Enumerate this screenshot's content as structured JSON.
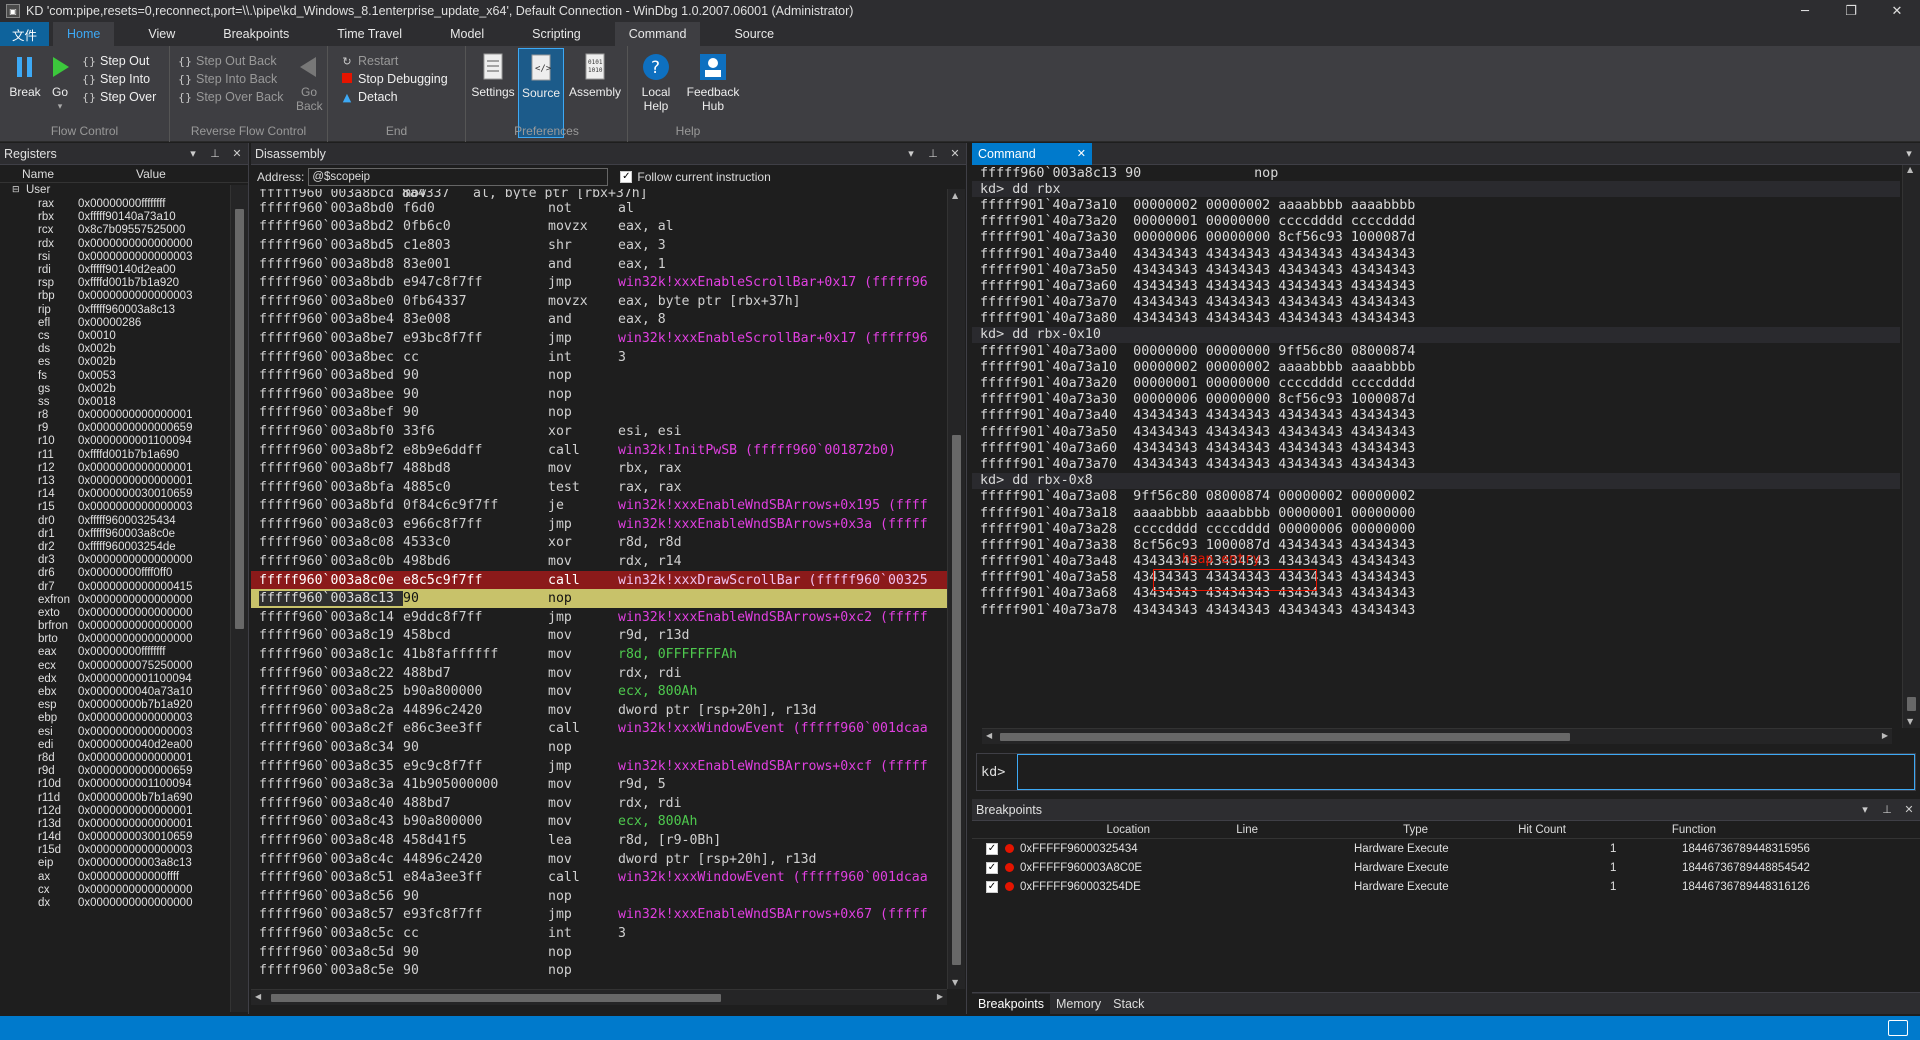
{
  "title": "KD 'com:pipe,resets=0,reconnect,port=\\\\.\\pipe\\kd_Windows_8.1enterprise_update_x64', Default Connection - WinDbg 1.0.2007.06001 (Administrator)",
  "ribbon_tabs": [
    "文件",
    "Home",
    "View",
    "Breakpoints",
    "Time Travel",
    "Model",
    "Scripting",
    "Command",
    "Source"
  ],
  "ribbon": {
    "flow": {
      "break": "Break",
      "go": "Go",
      "step_out": "Step Out",
      "step_into": "Step Into",
      "step_over": "Step Over",
      "label": "Flow Control"
    },
    "reverse": {
      "step_out_back": "Step Out Back",
      "step_into_back": "Step Into Back",
      "step_over_back": "Step Over Back",
      "go_back": "Go Back",
      "label": "Reverse Flow Control"
    },
    "end": {
      "restart": "Restart",
      "stop": "Stop Debugging",
      "detach": "Detach",
      "label": "End"
    },
    "prefs": {
      "settings": "Settings",
      "source": "Source",
      "assembly": "Assembly",
      "label": "Preferences"
    },
    "help": {
      "local_help": "Local Help",
      "feedback_hub": "Feedback Hub",
      "label": "Help"
    }
  },
  "registers": {
    "title": "Registers",
    "col_name": "Name",
    "col_value": "Value",
    "group": "User",
    "rows": [
      [
        "rax",
        "0x00000000ffffffff"
      ],
      [
        "rbx",
        "0xfffff90140a73a10"
      ],
      [
        "rcx",
        "0x8c7b09557525000"
      ],
      [
        "rdx",
        "0x0000000000000000"
      ],
      [
        "rsi",
        "0x0000000000000003"
      ],
      [
        "rdi",
        "0xfffff90140d2ea00"
      ],
      [
        "rsp",
        "0xffffd001b7b1a920"
      ],
      [
        "rbp",
        "0x0000000000000003"
      ],
      [
        "rip",
        "0xfffff960003a8c13"
      ],
      [
        "efl",
        "0x00000286"
      ],
      [
        "cs",
        "0x0010"
      ],
      [
        "ds",
        "0x002b"
      ],
      [
        "es",
        "0x002b"
      ],
      [
        "fs",
        "0x0053"
      ],
      [
        "gs",
        "0x002b"
      ],
      [
        "ss",
        "0x0018"
      ],
      [
        "r8",
        "0x0000000000000001"
      ],
      [
        "r9",
        "0x0000000000000659"
      ],
      [
        "r10",
        "0x0000000001100094"
      ],
      [
        "r11",
        "0xffffd001b7b1a690"
      ],
      [
        "r12",
        "0x0000000000000001"
      ],
      [
        "r13",
        "0x0000000000000001"
      ],
      [
        "r14",
        "0x0000000030010659"
      ],
      [
        "r15",
        "0x0000000000000003"
      ],
      [
        "dr0",
        "0xfffff96000325434"
      ],
      [
        "dr1",
        "0xfffff960003a8c0e"
      ],
      [
        "dr2",
        "0xfffff960003254de"
      ],
      [
        "dr3",
        "0x0000000000000000"
      ],
      [
        "dr6",
        "0x00000000ffff0ff0"
      ],
      [
        "dr7",
        "0x0000000000000415"
      ],
      [
        "exfron",
        "0x0000000000000000"
      ],
      [
        "exto",
        "0x0000000000000000"
      ],
      [
        "brfron",
        "0x0000000000000000"
      ],
      [
        "brto",
        "0x0000000000000000"
      ],
      [
        "eax",
        "0x00000000ffffffff"
      ],
      [
        "ecx",
        "0x0000000075250000"
      ],
      [
        "edx",
        "0x0000000001100094"
      ],
      [
        "ebx",
        "0x0000000040a73a10"
      ],
      [
        "esp",
        "0x00000000b7b1a920"
      ],
      [
        "ebp",
        "0x0000000000000003"
      ],
      [
        "esi",
        "0x0000000000000003"
      ],
      [
        "edi",
        "0x0000000040d2ea00"
      ],
      [
        "r8d",
        "0x0000000000000001"
      ],
      [
        "r9d",
        "0x0000000000000659"
      ],
      [
        "r10d",
        "0x0000000001100094"
      ],
      [
        "r11d",
        "0x00000000b7b1a690"
      ],
      [
        "r12d",
        "0x0000000000000001"
      ],
      [
        "r13d",
        "0x0000000000000001"
      ],
      [
        "r14d",
        "0x0000000030010659"
      ],
      [
        "r15d",
        "0x0000000000000003"
      ],
      [
        "eip",
        "0x00000000003a8c13"
      ],
      [
        "ax",
        "0x000000000000ffff"
      ],
      [
        "cx",
        "0x0000000000000000"
      ],
      [
        "dx",
        "0x0000000000000000"
      ]
    ]
  },
  "disassembly": {
    "title": "Disassembly",
    "address_label": "Address:",
    "address_value": "@$scopeip",
    "follow_label": "Follow current instruction",
    "top_partial": [
      "fffff960`003a8bcd 8a4337",
      "mov",
      "al, byte ptr [rbx+37h]"
    ],
    "rows": [
      [
        "fffff960`003a8bd0",
        "f6d0",
        "not",
        "al",
        "n"
      ],
      [
        "fffff960`003a8bd2",
        "0fb6c0",
        "movzx",
        "eax, al",
        "n"
      ],
      [
        "fffff960`003a8bd5",
        "c1e803",
        "shr",
        "eax, 3",
        "n"
      ],
      [
        "fffff960`003a8bd8",
        "83e001",
        "and",
        "eax, 1",
        "n"
      ],
      [
        "fffff960`003a8bdb",
        "e947c8f7ff",
        "jmp",
        "win32k!xxxEnableScrollBar+0x17 (fffff96",
        "s"
      ],
      [
        "fffff960`003a8be0",
        "0fb64337",
        "movzx",
        "eax, byte ptr [rbx+37h]",
        "n"
      ],
      [
        "fffff960`003a8be4",
        "83e008",
        "and",
        "eax, 8",
        "n"
      ],
      [
        "fffff960`003a8be7",
        "e93bc8f7ff",
        "jmp",
        "win32k!xxxEnableScrollBar+0x17 (fffff96",
        "s"
      ],
      [
        "fffff960`003a8bec",
        "cc",
        "int",
        "3",
        "n"
      ],
      [
        "fffff960`003a8bed",
        "90",
        "nop",
        "",
        "n"
      ],
      [
        "fffff960`003a8bee",
        "90",
        "nop",
        "",
        "n"
      ],
      [
        "fffff960`003a8bef",
        "90",
        "nop",
        "",
        "n"
      ],
      [
        "fffff960`003a8bf0",
        "33f6",
        "xor",
        "esi, esi",
        "n"
      ],
      [
        "fffff960`003a8bf2",
        "e8b9e6ddff",
        "call",
        "win32k!InitPwSB (fffff960`001872b0)",
        "s"
      ],
      [
        "fffff960`003a8bf7",
        "488bd8",
        "mov",
        "rbx, rax",
        "n"
      ],
      [
        "fffff960`003a8bfa",
        "4885c0",
        "test",
        "rax, rax",
        "n"
      ],
      [
        "fffff960`003a8bfd",
        "0f84c6c9f7ff",
        "je",
        "win32k!xxxEnableWndSBArrows+0x195 (ffff",
        "s"
      ],
      [
        "fffff960`003a8c03",
        "e966c8f7ff",
        "jmp",
        "win32k!xxxEnableWndSBArrows+0x3a (fffff",
        "s"
      ],
      [
        "fffff960`003a8c08",
        "4533c0",
        "xor",
        "r8d, r8d",
        "n"
      ],
      [
        "fffff960`003a8c0b",
        "498bd6",
        "mov",
        "rdx, r14",
        "n"
      ],
      [
        "fffff960`003a8c0e",
        "e8c5c9f7ff",
        "call",
        "win32k!xxxDrawScrollBar (fffff960`00325",
        "bp"
      ],
      [
        "fffff960`003a8c13",
        "90",
        "nop",
        "",
        "cur"
      ],
      [
        "fffff960`003a8c14",
        "e9ddc8f7ff",
        "jmp",
        "win32k!xxxEnableWndSBArrows+0xc2 (fffff",
        "s"
      ],
      [
        "fffff960`003a8c19",
        "458bcd",
        "mov",
        "r9d, r13d",
        "n"
      ],
      [
        "fffff960`003a8c1c",
        "41b8faffffff",
        "mov",
        "r8d, 0FFFFFFFAh",
        "g"
      ],
      [
        "fffff960`003a8c22",
        "488bd7",
        "mov",
        "rdx, rdi",
        "n"
      ],
      [
        "fffff960`003a8c25",
        "b90a800000",
        "mov",
        "ecx, 800Ah",
        "g"
      ],
      [
        "fffff960`003a8c2a",
        "44896c2420",
        "mov",
        "dword ptr [rsp+20h], r13d",
        "n"
      ],
      [
        "fffff960`003a8c2f",
        "e86c3ee3ff",
        "call",
        "win32k!xxxWindowEvent (fffff960`001dcaa",
        "s"
      ],
      [
        "fffff960`003a8c34",
        "90",
        "nop",
        "",
        "n"
      ],
      [
        "fffff960`003a8c35",
        "e9c9c8f7ff",
        "jmp",
        "win32k!xxxEnableWndSBArrows+0xcf (fffff",
        "s"
      ],
      [
        "fffff960`003a8c3a",
        "41b905000000",
        "mov",
        "r9d, 5",
        "n"
      ],
      [
        "fffff960`003a8c40",
        "488bd7",
        "mov",
        "rdx, rdi",
        "n"
      ],
      [
        "fffff960`003a8c43",
        "b90a800000",
        "mov",
        "ecx, 800Ah",
        "g"
      ],
      [
        "fffff960`003a8c48",
        "458d41f5",
        "lea",
        "r8d, [r9-0Bh]",
        "n"
      ],
      [
        "fffff960`003a8c4c",
        "44896c2420",
        "mov",
        "dword ptr [rsp+20h], r13d",
        "n"
      ],
      [
        "fffff960`003a8c51",
        "e84a3ee3ff",
        "call",
        "win32k!xxxWindowEvent (fffff960`001dcaa",
        "s"
      ],
      [
        "fffff960`003a8c56",
        "90",
        "nop",
        "",
        "n"
      ],
      [
        "fffff960`003a8c57",
        "e93fc8f7ff",
        "jmp",
        "win32k!xxxEnableWndSBArrows+0x67 (fffff",
        "s"
      ],
      [
        "fffff960`003a8c5c",
        "cc",
        "int",
        "3",
        "n"
      ],
      [
        "fffff960`003a8c5d",
        "90",
        "nop",
        "",
        "n"
      ],
      [
        "fffff960`003a8c5e",
        "90",
        "nop",
        "",
        "n"
      ]
    ]
  },
  "command": {
    "title": "Command",
    "prompt": "kd>",
    "heap_note": "heap entry",
    "lines": [
      "fffff960`003a8c13 90              nop",
      "kd> dd rbx",
      "fffff901`40a73a10  00000002 00000002 aaaabbbb aaaabbbb",
      "fffff901`40a73a20  00000001 00000000 ccccdddd ccccdddd",
      "fffff901`40a73a30  00000006 00000000 8cf56c93 1000087d",
      "fffff901`40a73a40  43434343 43434343 43434343 43434343",
      "fffff901`40a73a50  43434343 43434343 43434343 43434343",
      "fffff901`40a73a60  43434343 43434343 43434343 43434343",
      "fffff901`40a73a70  43434343 43434343 43434343 43434343",
      "fffff901`40a73a80  43434343 43434343 43434343 43434343",
      "kd> dd rbx-0x10",
      "fffff901`40a73a00  00000000 00000000 9ff56c80 08000874",
      "fffff901`40a73a10  00000002 00000002 aaaabbbb aaaabbbb",
      "fffff901`40a73a20  00000001 00000000 ccccdddd ccccdddd",
      "fffff901`40a73a30  00000006 00000000 8cf56c93 1000087d",
      "fffff901`40a73a40  43434343 43434343 43434343 43434343",
      "fffff901`40a73a50  43434343 43434343 43434343 43434343",
      "fffff901`40a73a60  43434343 43434343 43434343 43434343",
      "fffff901`40a73a70  43434343 43434343 43434343 43434343",
      "kd> dd rbx-0x8",
      "fffff901`40a73a08  9ff56c80 08000874 00000002 00000002",
      "fffff901`40a73a18  aaaabbbb aaaabbbb 00000001 00000000",
      "fffff901`40a73a28  ccccdddd ccccdddd 00000006 00000000",
      "fffff901`40a73a38  8cf56c93 1000087d 43434343 43434343",
      "fffff901`40a73a48  43434343 43434343 43434343 43434343",
      "fffff901`40a73a58  43434343 43434343 43434343 43434343",
      "fffff901`40a73a68  43434343 43434343 43434343 43434343",
      "fffff901`40a73a78  43434343 43434343 43434343 43434343"
    ]
  },
  "breakpoints": {
    "title": "Breakpoints",
    "columns": [
      "Location",
      "Line",
      "Type",
      "Hit Count",
      "Function"
    ],
    "rows": [
      [
        "0xFFFFF96000325434",
        "",
        "Hardware Execute",
        "1",
        "18446736789448315956"
      ],
      [
        "0xFFFFF960003A8C0E",
        "",
        "Hardware Execute",
        "1",
        "18446736789448854542"
      ],
      [
        "0xFFFFF960003254DE",
        "",
        "Hardware Execute",
        "1",
        "18446736789448316126"
      ]
    ],
    "bottom_tabs": [
      "Breakpoints",
      "Memory",
      "Stack"
    ]
  },
  "colors": {
    "accent": "#007acc",
    "breakpoint": "#8b1a1a",
    "current": "#c8c26a",
    "symbol": "#e040e0",
    "number": "#4ec94e",
    "heap_note": "#e51400"
  }
}
